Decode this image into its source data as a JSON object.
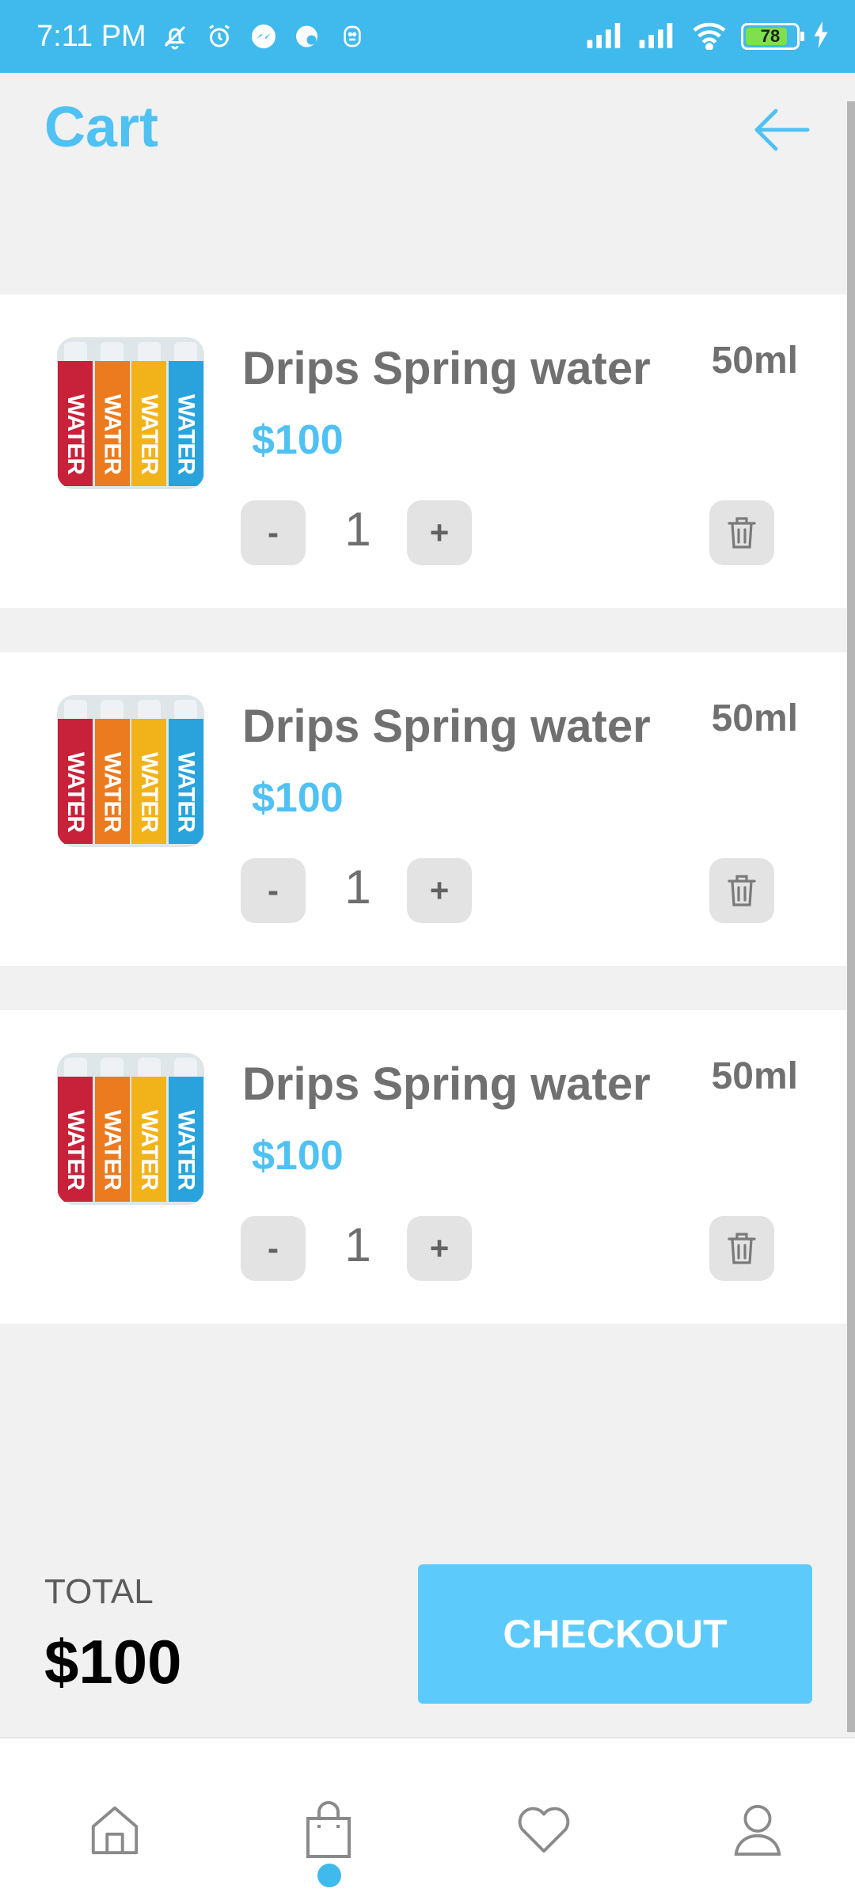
{
  "status_bar": {
    "time": "7:11 PM",
    "battery": "78",
    "icons": [
      "bell-off-icon",
      "alarm-icon",
      "messenger-icon",
      "chat-icon",
      "face-icon",
      "signal-icon",
      "signal-icon",
      "wifi-icon",
      "battery-icon",
      "charging-icon"
    ]
  },
  "header": {
    "title": "Cart",
    "back_icon": "arrow-left-icon"
  },
  "cart": {
    "items": [
      {
        "name": "Drips Spring water",
        "size": "50ml",
        "price": "$100",
        "quantity": "1",
        "minus": "-",
        "plus": "+",
        "can_label": "WATER"
      },
      {
        "name": "Drips Spring water",
        "size": "50ml",
        "price": "$100",
        "quantity": "1",
        "minus": "-",
        "plus": "+",
        "can_label": "WATER"
      },
      {
        "name": "Drips Spring water",
        "size": "50ml",
        "price": "$100",
        "quantity": "1",
        "minus": "-",
        "plus": "+",
        "can_label": "WATER"
      }
    ]
  },
  "summary": {
    "total_label": "TOTAL",
    "total_value": "$100",
    "checkout_label": "CHECKOUT"
  },
  "bottom_nav": {
    "items": [
      "home-icon",
      "shopping-bag-icon",
      "heart-icon",
      "user-icon"
    ],
    "active": "shopping-bag-icon"
  },
  "colors": {
    "accent": "#4fc1f2",
    "status_bar": "#40b9ec",
    "checkout": "#5ccbfb",
    "can_red": "#c8213a",
    "can_orange": "#ec7a1e",
    "can_yellow": "#f2b21a",
    "can_blue": "#2aa3dd"
  }
}
